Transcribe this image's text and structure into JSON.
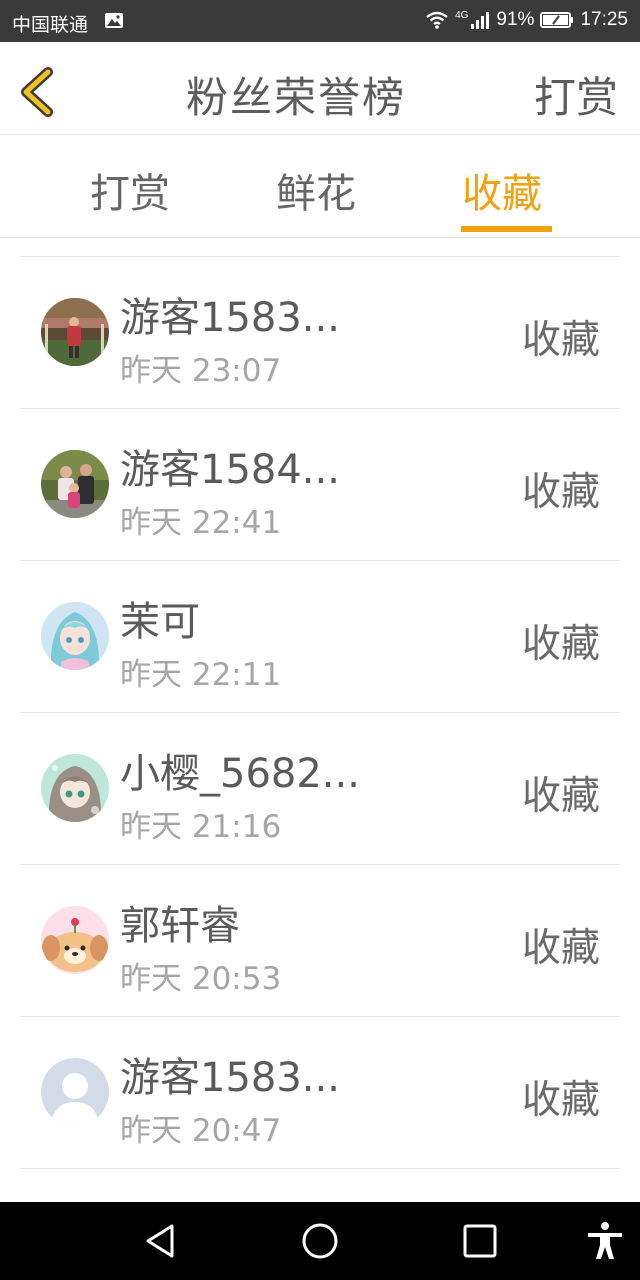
{
  "status_bar": {
    "carrier": "中国联通",
    "network": "4G",
    "battery": "91%",
    "time": "17:25"
  },
  "header": {
    "title": "粉丝荣誉榜",
    "right_action": "打赏"
  },
  "tabs": [
    {
      "label": "打赏",
      "active": false
    },
    {
      "label": "鲜花",
      "active": false
    },
    {
      "label": "收藏",
      "active": true
    }
  ],
  "colors": {
    "accent": "#f1a20f",
    "status_bar_bg": "#3a3a3a",
    "nav_bar_bg": "#000000"
  },
  "list": [
    {
      "name": "游客1583...",
      "time": "昨天 23:07",
      "action": "收藏",
      "avatar": "photo-outdoor-avatar"
    },
    {
      "name": "游客1584...",
      "time": "昨天 22:41",
      "action": "收藏",
      "avatar": "photo-family-avatar"
    },
    {
      "name": "茉可",
      "time": "昨天 22:11",
      "action": "收藏",
      "avatar": "anime-girl-avatar"
    },
    {
      "name": "小樱_5682...",
      "time": "昨天 21:16",
      "action": "收藏",
      "avatar": "anime-girl-avatar"
    },
    {
      "name": "郭轩睿",
      "time": "昨天 20:53",
      "action": "收藏",
      "avatar": "cartoon-dog-avatar"
    },
    {
      "name": "游客1583...",
      "time": "昨天 20:47",
      "action": "收藏",
      "avatar": "default-user-avatar"
    }
  ],
  "nav_bar": {
    "buttons": [
      "back-triangle-icon",
      "home-circle-icon",
      "recents-square-icon",
      "accessibility-icon"
    ]
  }
}
